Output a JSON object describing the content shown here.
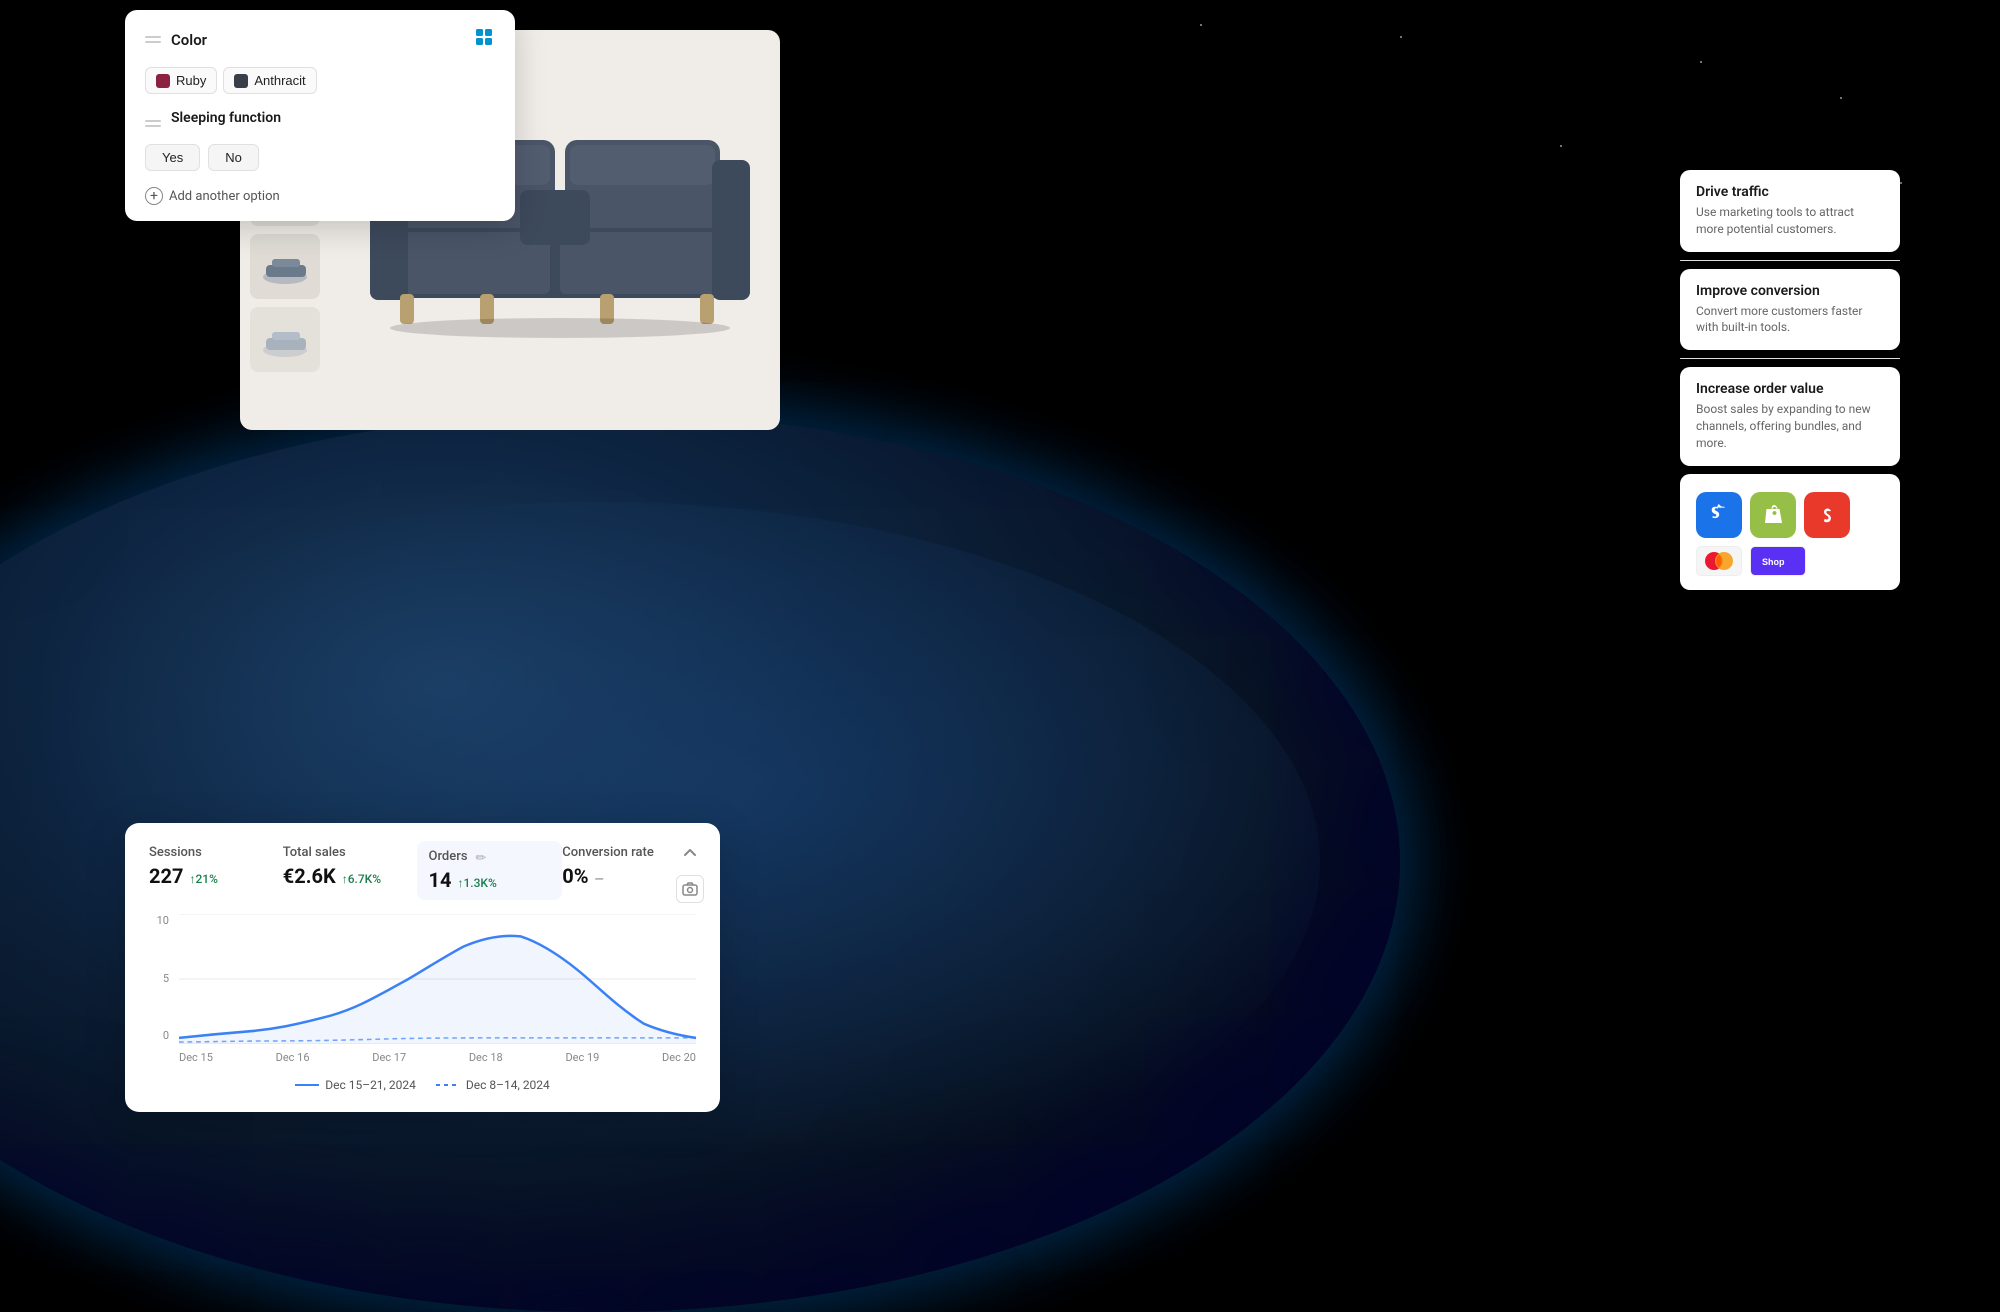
{
  "background": {
    "earth_color": "#0d2440",
    "atmosphere_color": "#0066ff"
  },
  "color_card": {
    "title": "Color",
    "drag_label": "drag-handle",
    "shopify_icon": "shopify-icon",
    "colors": [
      {
        "label": "Ruby",
        "dot_class": "ruby-dot"
      },
      {
        "label": "Anthracit",
        "dot_class": "anthracit-dot"
      }
    ],
    "sleeping_title": "Sleeping function",
    "sleeping_options": [
      "Yes",
      "No"
    ],
    "add_option_label": "Add another option"
  },
  "analytics_card": {
    "metrics": [
      {
        "label": "Sessions",
        "value": "227",
        "change": "↑21%",
        "change_type": "up"
      },
      {
        "label": "Total sales",
        "value": "€2.6K",
        "change": "↑6.7K%",
        "change_type": "up"
      },
      {
        "label": "Orders",
        "value": "14",
        "change": "↑1.3K%",
        "change_type": "up",
        "active": true
      },
      {
        "label": "Conversion rate",
        "value": "0%",
        "change": "—",
        "change_type": "neutral"
      }
    ],
    "chart": {
      "y_labels": [
        "0",
        "5",
        "10"
      ],
      "x_labels": [
        "Dec 15",
        "Dec 16",
        "Dec 17",
        "Dec 18",
        "Dec 19",
        "Dec 20"
      ],
      "legend": [
        {
          "label": "Dec 15–21, 2024",
          "style": "solid"
        },
        {
          "label": "Dec 8–14, 2024",
          "style": "dashed"
        }
      ]
    }
  },
  "right_panel": {
    "cards": [
      {
        "title": "Drive traffic",
        "desc": "Use marketing tools to attract more potential customers."
      },
      {
        "title": "Improve conversion",
        "desc": "Convert more customers faster with built-in tools."
      },
      {
        "title": "Increase order value",
        "desc": "Boost sales by expanding to new channels, offering bundles, and more."
      }
    ],
    "apps_label": "apps-section"
  }
}
